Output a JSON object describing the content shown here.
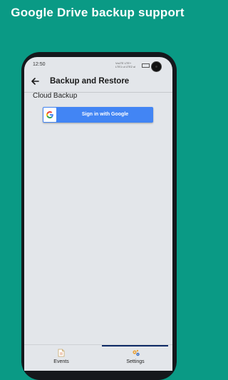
{
  "promo": {
    "title": "Google Drive backup support"
  },
  "status_bar": {
    "time": "12:50",
    "network_line1": "VoLTE LTE+",
    "network_line2": "LTE1 ul  LTE2 ul"
  },
  "appbar": {
    "title": "Backup and Restore"
  },
  "cloud_backup": {
    "section_title": "Cloud Backup",
    "signin_label": "Sign in with Google"
  },
  "bottom_nav": {
    "items": [
      {
        "label": "Events",
        "icon": "document-icon",
        "selected": false
      },
      {
        "label": "Settings",
        "icon": "gears-icon",
        "selected": true
      }
    ]
  },
  "colors": {
    "background": "#0a9a85",
    "google_button": "#4285f4",
    "nav_indicator": "#0d2a66",
    "screen": "#e3e6ea"
  }
}
